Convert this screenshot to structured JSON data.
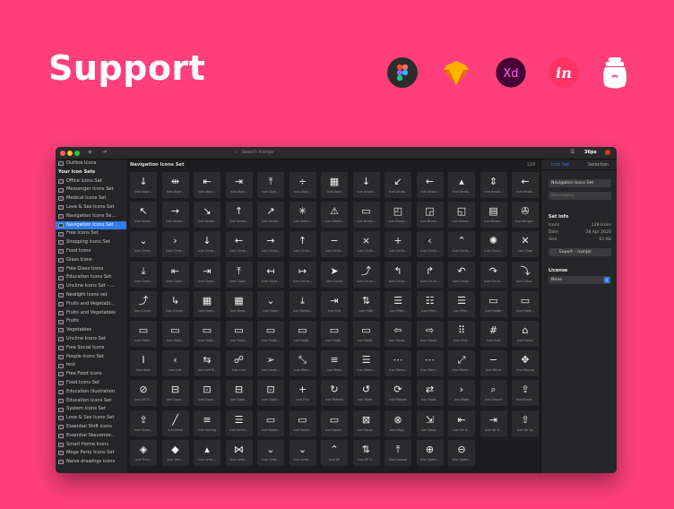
{
  "headline": "Support",
  "logos": [
    "figma-logo",
    "sketch-logo",
    "adobe-xd-logo",
    "invision-logo",
    "iconjar-logo"
  ],
  "xd_text": "Xd",
  "invision_text": "in",
  "window": {
    "search_placeholder": "Search IconJar",
    "size_label": "36px",
    "tabs": [
      "Icon Set",
      "Selection"
    ]
  },
  "sidebar": {
    "items": [
      {
        "label": "Outline Icons",
        "type": "item"
      },
      {
        "label": "Your Icon Sets",
        "type": "head"
      },
      {
        "label": "Office Icons Set",
        "type": "item"
      },
      {
        "label": "Messenger Icons Set",
        "type": "item"
      },
      {
        "label": "Medical Icons Set",
        "type": "item"
      },
      {
        "label": "Love & Sex Icons Set",
        "type": "item"
      },
      {
        "label": "Navigation Icons Se...",
        "type": "item"
      },
      {
        "label": "Navigation Icons Set",
        "type": "sel"
      },
      {
        "label": "Free Icons Set",
        "type": "item"
      },
      {
        "label": "Shopping Icons Set",
        "type": "item"
      },
      {
        "label": "Food Icons",
        "type": "item"
      },
      {
        "label": "Glass Icons",
        "type": "item"
      },
      {
        "label": "Free Glass Icons",
        "type": "item"
      },
      {
        "label": "Education Icons Set",
        "type": "item"
      },
      {
        "label": "Uncline Icons Set - ...",
        "type": "item"
      },
      {
        "label": "Neolight Icons set",
        "type": "item"
      },
      {
        "label": "Fruits and Vegetabl...",
        "type": "item"
      },
      {
        "label": "Fruits and Vegetables",
        "type": "item"
      },
      {
        "label": "Fruits",
        "type": "item"
      },
      {
        "label": "Vegetables",
        "type": "item"
      },
      {
        "label": "Uncline Icons Set",
        "type": "item"
      },
      {
        "label": "Free Social Icons",
        "type": "item"
      },
      {
        "label": "People Icons Set",
        "type": "item"
      },
      {
        "label": "test",
        "type": "item"
      },
      {
        "label": "Free Food Icons",
        "type": "item"
      },
      {
        "label": "Food Icons Set",
        "type": "item"
      },
      {
        "label": "Education Illustration",
        "type": "item"
      },
      {
        "label": "Education Icons Set",
        "type": "item"
      },
      {
        "label": "System Icons Set",
        "type": "item"
      },
      {
        "label": "Love & Sex Icons Set",
        "type": "item"
      },
      {
        "label": "Essential Shift Icons",
        "type": "item"
      },
      {
        "label": "Essential Skeuomor...",
        "type": "item"
      },
      {
        "label": "Smart Home Icons",
        "type": "item"
      },
      {
        "label": "Mega Party Icons Set",
        "type": "item"
      },
      {
        "label": "Naive drawings icons",
        "type": "item"
      }
    ]
  },
  "main": {
    "title": "Navigation Icons Set",
    "count": "128",
    "icons": [
      {
        "g": "↓",
        "l": "Icon Align..."
      },
      {
        "g": "⇹",
        "l": "Icon Align..."
      },
      {
        "g": "⇤",
        "l": "Icon Align..."
      },
      {
        "g": "⇥",
        "l": "Icon Align..."
      },
      {
        "g": "⤒",
        "l": "Icon Align..."
      },
      {
        "g": "÷",
        "l": "Icon Align..."
      },
      {
        "g": "▦",
        "l": "Icon Apps"
      },
      {
        "g": "↓",
        "l": "Icon Arrow..."
      },
      {
        "g": "↙",
        "l": "Icon Arrow..."
      },
      {
        "g": "←",
        "l": "Icon Arrow..."
      },
      {
        "g": "▴",
        "l": "Icon Arrow..."
      },
      {
        "g": "⇕",
        "l": "Icon Arrow..."
      },
      {
        "g": "←",
        "l": "Icon Arrow..."
      },
      {
        "g": "↖",
        "l": "Icon Arrow..."
      },
      {
        "g": "→",
        "l": "Icon Arrow..."
      },
      {
        "g": "↘",
        "l": "Icon Arrow..."
      },
      {
        "g": "↑",
        "l": "Icon Arrow..."
      },
      {
        "g": "↗",
        "l": "Icon Arrow..."
      },
      {
        "g": "✳",
        "l": "Icon Asteri..."
      },
      {
        "g": "⚠",
        "l": "Icon Attent..."
      },
      {
        "g": "▭",
        "l": "Icon Brows..."
      },
      {
        "g": "◰",
        "l": "Icon Brows..."
      },
      {
        "g": "◲",
        "l": "Icon Brows..."
      },
      {
        "g": "◱",
        "l": "Icon Brows..."
      },
      {
        "g": "▤",
        "l": "Icon Brows..."
      },
      {
        "g": "✇",
        "l": "Icon Burger..."
      },
      {
        "g": "⌄",
        "l": "Icon Circle..."
      },
      {
        "g": "›",
        "l": "Icon Circle..."
      },
      {
        "g": "↓",
        "l": "Icon Circle..."
      },
      {
        "g": "←",
        "l": "Icon Circle..."
      },
      {
        "g": "→",
        "l": "Icon Circle..."
      },
      {
        "g": "↑",
        "l": "Icon Circle..."
      },
      {
        "g": "−",
        "l": "Icon Circle..."
      },
      {
        "g": "×",
        "l": "Icon Circle..."
      },
      {
        "g": "+",
        "l": "Icon Circle..."
      },
      {
        "g": "‹",
        "l": "Icon Circle..."
      },
      {
        "g": "⌃",
        "l": "Icon Circle..."
      },
      {
        "g": "✺",
        "l": "Icon Circul..."
      },
      {
        "g": "✕",
        "l": "Icon Close"
      },
      {
        "g": "⤓",
        "l": "Icon Close..."
      },
      {
        "g": "⇤",
        "l": "Icon Close..."
      },
      {
        "g": "⇥",
        "l": "Icon Close..."
      },
      {
        "g": "⤒",
        "l": "Icon Close..."
      },
      {
        "g": "↤",
        "l": "Icon Close..."
      },
      {
        "g": "↦",
        "l": "Icon Corne..."
      },
      {
        "g": "➤",
        "l": "Icon Cursor"
      },
      {
        "g": "⤴",
        "l": "Icon Curve..."
      },
      {
        "g": "↰",
        "l": "Icon Curve..."
      },
      {
        "g": "↱",
        "l": "Icon Curve..."
      },
      {
        "g": "↶",
        "l": "Icon Curve..."
      },
      {
        "g": "↷",
        "l": "Icon Curve..."
      },
      {
        "g": "⤵",
        "l": "Icon Curve..."
      },
      {
        "g": "⤴",
        "l": "Icon Curve..."
      },
      {
        "g": "↳",
        "l": "Icon Curve..."
      },
      {
        "g": "▦",
        "l": "Icon Dash..."
      },
      {
        "g": "▦",
        "l": "Icon Dash..."
      },
      {
        "g": "⌄",
        "l": "Icon Down"
      },
      {
        "g": "⤓",
        "l": "Icon Downl..."
      },
      {
        "g": "⇥",
        "l": "Icon Exit"
      },
      {
        "g": "⇅",
        "l": "Icon Filter"
      },
      {
        "g": "☰",
        "l": "Icon Filter..."
      },
      {
        "g": "☷",
        "l": "Icon Filter..."
      },
      {
        "g": "☰",
        "l": "Icon Filter..."
      },
      {
        "g": "▭",
        "l": "Icon Folder"
      },
      {
        "g": "▭",
        "l": "Icon Folde..."
      },
      {
        "g": "▭",
        "l": "Icon Folde..."
      },
      {
        "g": "▭",
        "l": "Icon Folde..."
      },
      {
        "g": "▭",
        "l": "Icon Folde..."
      },
      {
        "g": "▭",
        "l": "Icon Folde..."
      },
      {
        "g": "▭",
        "l": "Icon Folde..."
      },
      {
        "g": "▭",
        "l": "Icon Folde..."
      },
      {
        "g": "▭",
        "l": "Icon Folde..."
      },
      {
        "g": "▭",
        "l": "Icon Folde..."
      },
      {
        "g": "⇦",
        "l": "Icon Forwa..."
      },
      {
        "g": "⇨",
        "l": "Icon Forwa..."
      },
      {
        "g": "⠿",
        "l": "Icon Grid..."
      },
      {
        "g": "#",
        "l": "Icon Grid"
      },
      {
        "g": "⌂",
        "l": "Icon Home"
      },
      {
        "g": "I",
        "l": "Icon Italic"
      },
      {
        "g": "‹",
        "l": "Icon Left"
      },
      {
        "g": "⇆",
        "l": "Icon Left R..."
      },
      {
        "g": "☍",
        "l": "Icon Link"
      },
      {
        "g": "➢",
        "l": "Icon Locali..."
      },
      {
        "g": "⤡",
        "l": "Icon Maxi..."
      },
      {
        "g": "≡",
        "l": "Icon Menu"
      },
      {
        "g": "☰",
        "l": "Icon Menu..."
      },
      {
        "g": "⋯",
        "l": "Icon Menu..."
      },
      {
        "g": "⋯",
        "l": "Icon Menu..."
      },
      {
        "g": "⤢",
        "l": "Icon Minim..."
      },
      {
        "g": "−",
        "l": "Icon Minus"
      },
      {
        "g": "✥",
        "l": "Icon Moving"
      },
      {
        "g": "⊘",
        "l": "Icon NO A..."
      },
      {
        "g": "⊟",
        "l": "Icon Open..."
      },
      {
        "g": "⊡",
        "l": "Icon Open..."
      },
      {
        "g": "⊟",
        "l": "Icon Open..."
      },
      {
        "g": "⊡",
        "l": "Icon Open..."
      },
      {
        "g": "+",
        "l": "Icon Plus"
      },
      {
        "g": "↻",
        "l": "Icon Refresh"
      },
      {
        "g": "↺",
        "l": "Icon Refre..."
      },
      {
        "g": "⟳",
        "l": "Icon Reload"
      },
      {
        "g": "⇄",
        "l": "Icon Rotat..."
      },
      {
        "g": "›",
        "l": "Icon Right"
      },
      {
        "g": "⌕",
        "l": "Icon Search"
      },
      {
        "g": "⇪",
        "l": "Icon Share..."
      },
      {
        "g": "⇪",
        "l": "Icon Share..."
      },
      {
        "g": "╱",
        "l": "Icon Slash"
      },
      {
        "g": "≡",
        "l": "Icon Sorting"
      },
      {
        "g": "☰",
        "l": "Icon Sortin..."
      },
      {
        "g": "▭",
        "l": "Icon Squar..."
      },
      {
        "g": "▭",
        "l": "Icon Squar..."
      },
      {
        "g": "▭",
        "l": "Icon Squar..."
      },
      {
        "g": "⊠",
        "l": "Icon Squar..."
      },
      {
        "g": "⊗",
        "l": "Icon Stop..."
      },
      {
        "g": "⇲",
        "l": "Icon Swap..."
      },
      {
        "g": "⇤",
        "l": "Icon Str B..."
      },
      {
        "g": "⇥",
        "l": "Icon Str B..."
      },
      {
        "g": "⇧",
        "l": "Icon Str Up"
      },
      {
        "g": "◈",
        "l": "Icon Turn..."
      },
      {
        "g": "◆",
        "l": "Icon Turn..."
      },
      {
        "g": "▴",
        "l": "Icon Unfol..."
      },
      {
        "g": "⋈",
        "l": "Icon Unfol..."
      },
      {
        "g": "⌄",
        "l": "Icon Unfol..."
      },
      {
        "g": "⌄",
        "l": "Icon Unfol..."
      },
      {
        "g": "⌃",
        "l": "Icon UP"
      },
      {
        "g": "⇅",
        "l": "Icon UP D..."
      },
      {
        "g": "⤒",
        "l": "Icon Upload"
      },
      {
        "g": "⊕",
        "l": "Icon Zoom..."
      },
      {
        "g": "⊖",
        "l": "Icon Zoom..."
      }
    ]
  },
  "right": {
    "name_value": "Navigation Icons Set",
    "description_placeholder": "Description",
    "set_info_title": "Set Info",
    "info": [
      {
        "k": "Icons",
        "v": "128 Icons"
      },
      {
        "k": "Date",
        "v": "28 Apr 2020"
      },
      {
        "k": "Size",
        "v": "61 KB"
      }
    ],
    "export_label": "Export – IconJar",
    "license_title": "License",
    "license_value": "None"
  }
}
